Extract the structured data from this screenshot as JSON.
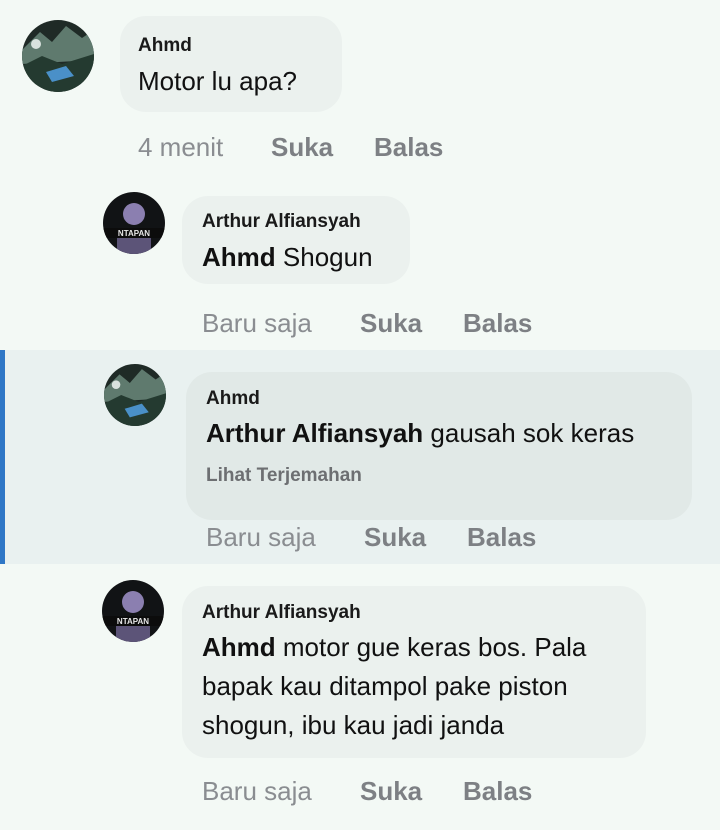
{
  "comments": [
    {
      "author": "Ahmd",
      "mention": "",
      "text": "Motor lu apa?",
      "time": "4 menit",
      "like": "Suka",
      "reply": "Balas"
    },
    {
      "author": "Arthur Alfiansyah",
      "mention": "Ahmd",
      "text": " Shogun",
      "time": "Baru saja",
      "like": "Suka",
      "reply": "Balas",
      "avatar_text": "NTAPAN"
    },
    {
      "author": "Ahmd",
      "mention": "Arthur Alfiansyah",
      "text": " gausah sok keras",
      "translate": "Lihat Terjemahan",
      "time": "Baru saja",
      "like": "Suka",
      "reply": "Balas"
    },
    {
      "author": "Arthur Alfiansyah",
      "mention": "Ahmd",
      "text_line1": " motor gue keras bos. Pala",
      "text_line2": "bapak kau ditampol pake piston",
      "text_line3": "shogun, ibu kau jadi janda",
      "time": "Baru saja",
      "like": "Suka",
      "reply": "Balas",
      "avatar_text": "NTAPAN"
    }
  ]
}
